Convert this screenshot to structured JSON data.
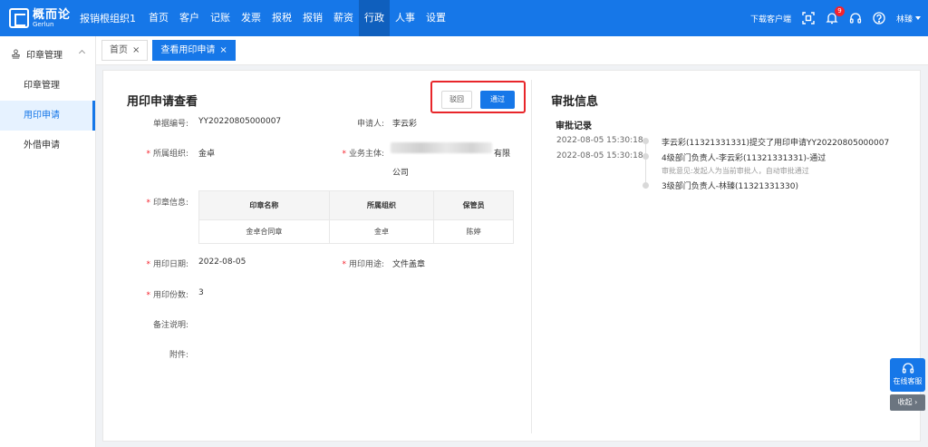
{
  "header": {
    "logo_cn": "概而论",
    "logo_en": "Gerlun",
    "org": "报销根组织1",
    "nav": [
      "首页",
      "客户",
      "记账",
      "发票",
      "报税",
      "报销",
      "薪资",
      "行政",
      "人事",
      "设置"
    ],
    "active_nav": "行政",
    "download": "下载客户端",
    "notification_count": "9",
    "user": "林臻"
  },
  "sidebar": {
    "group": "印章管理",
    "items": [
      "印章管理",
      "用印申请",
      "外借申请"
    ],
    "active_item": "用印申请"
  },
  "tabs": [
    {
      "label": "首页",
      "close": "×"
    },
    {
      "label": "查看用印申请",
      "close": "×"
    }
  ],
  "form": {
    "title": "用印申请查看",
    "reject_label": "驳回",
    "pass_label": "通过",
    "doc_no_label": "单据编号:",
    "doc_no": "YY20220805000007",
    "applicant_label": "申请人:",
    "applicant": "李云彩",
    "org_label": "所属组织:",
    "org": "金卓",
    "entity_label": "业务主体:",
    "entity_suffix": "有限",
    "entity_line2": "公司",
    "seal_info_label": "印章信息:",
    "seal_table": {
      "headers": [
        "印章名称",
        "所属组织",
        "保管员"
      ],
      "rows": [
        [
          "金卓合同章",
          "金卓",
          "陈婷"
        ]
      ]
    },
    "use_date_label": "用印日期:",
    "use_date": "2022-08-05",
    "purpose_label": "用印用途:",
    "purpose": "文件盖章",
    "copies_label": "用印份数:",
    "copies": "3",
    "remark_label": "备注说明:",
    "attachment_label": "附件:"
  },
  "approval": {
    "title": "审批信息",
    "record_title": "审批记录",
    "records": [
      {
        "time": "2022-08-05 15:30:18",
        "text": "李云彩(11321331331)提交了用印申请YY20220805000007"
      },
      {
        "time": "2022-08-05 15:30:18",
        "text": "4级部门负责人-李云彩(11321331331)-通过",
        "note": "审批意见:发起人为当前审批人，自动审批通过"
      },
      {
        "time": "",
        "text": "3级部门负责人-林臻(11321331330)"
      }
    ]
  },
  "float": {
    "service_label": "在线客服",
    "collapse_label": "收起 ›"
  }
}
